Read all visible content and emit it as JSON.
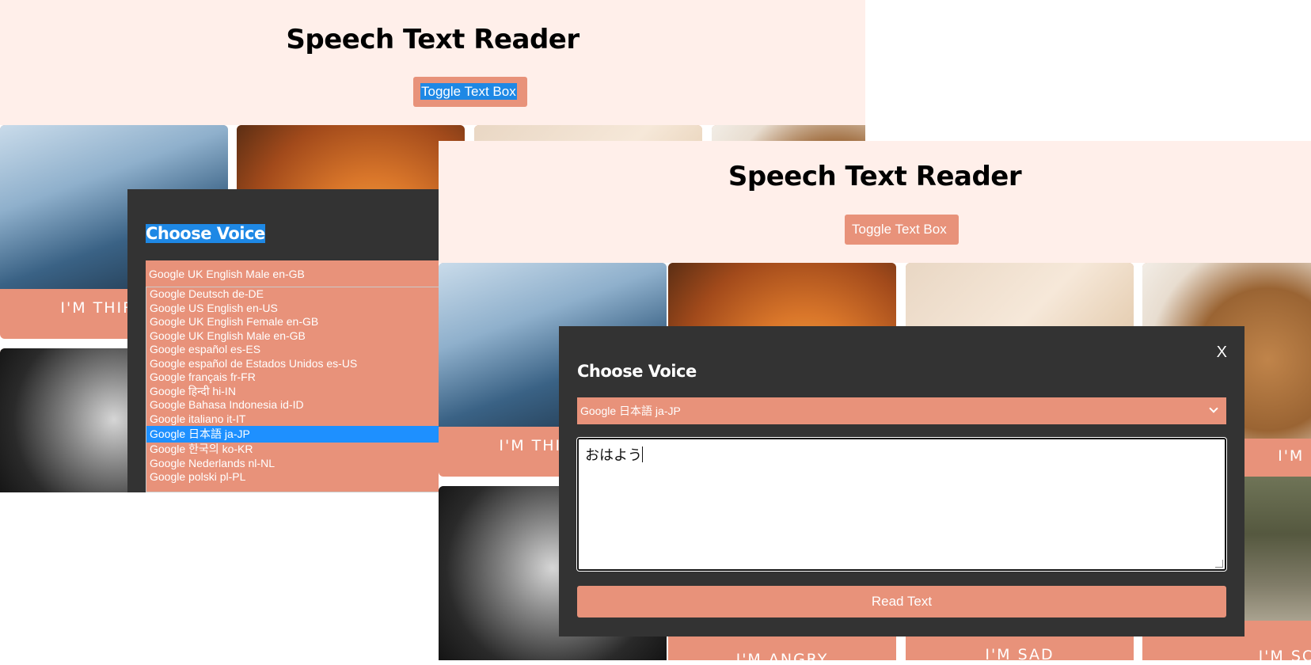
{
  "back_window": {
    "title": "Speech Text Reader",
    "toggle_label": "Toggle Text Box",
    "cards": [
      {
        "label": "I'M THIRSTY"
      },
      {
        "label": ""
      },
      {
        "label": ""
      },
      {
        "label": ""
      },
      {
        "label": ""
      }
    ],
    "panel": {
      "title": "Choose Voice",
      "selected_voice": "Google UK English Male en-GB",
      "voice_options": [
        "Google Deutsch de-DE",
        "Google US English en-US",
        "Google UK English Female en-GB",
        "Google UK English Male en-GB",
        "Google español es-ES",
        "Google español de Estados Unidos es-US",
        "Google français fr-FR",
        "Google हिन्दी hi-IN",
        "Google Bahasa Indonesia id-ID",
        "Google italiano it-IT",
        "Google 日本語 ja-JP",
        "Google 한국의 ko-KR",
        "Google Nederlands nl-NL",
        "Google polski pl-PL"
      ],
      "highlighted_option": "Google 日本語 ja-JP"
    }
  },
  "front_window": {
    "title": "Speech Text Reader",
    "toggle_label": "Toggle Text Box",
    "cards": [
      {
        "label": "I'M THIRSTY"
      },
      {
        "label": ""
      },
      {
        "label": ""
      },
      {
        "label": "I'M HURT"
      },
      {
        "label": ""
      },
      {
        "label": "I'M ANGRY"
      },
      {
        "label": "I'M SAD"
      },
      {
        "label": "I'M SCARED"
      }
    ],
    "panel": {
      "title": "Choose Voice",
      "close_label": "X",
      "selected_voice": "Google 日本語 ja-JP",
      "text_value": "おはよう",
      "read_label": "Read Text"
    }
  },
  "colors": {
    "accent": "#e8927a",
    "header_bg": "#ffefea",
    "panel_bg": "#333333",
    "highlight": "#1e90ff"
  },
  "icons": [
    "chevron-down-icon",
    "close-icon",
    "resize-grip-icon",
    "text-caret-icon"
  ]
}
